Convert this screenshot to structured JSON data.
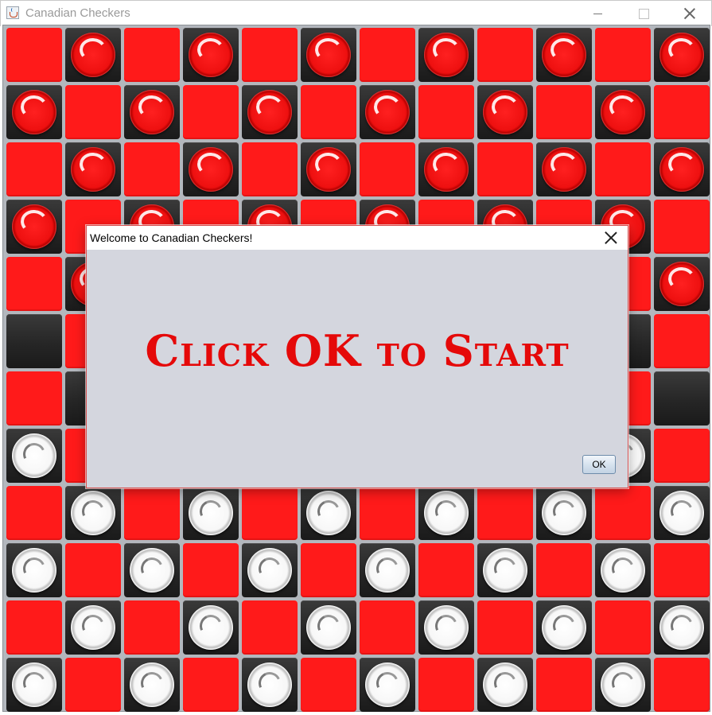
{
  "window": {
    "title": "Canadian Checkers",
    "controls": [
      "minimize",
      "maximize",
      "close"
    ]
  },
  "board": {
    "rows": 12,
    "cols": 12,
    "colors": {
      "light_square": "#ff1a1a",
      "dark_square": "#2a2a2a",
      "red_piece": "#ee1010",
      "white_piece": "#f7f7f7"
    },
    "layout": [
      ".r.r.r.r.r.r",
      "r.r.r.r.r.r.",
      ".r.r.r.r.r.r",
      "r.r.r.r.r.r.",
      ".r.r.r.r.r.r",
      "............",
      "............",
      "w.w.w.w.w.w.",
      ".w.w.w.w.w.w",
      "w.w.w.w.w.w.",
      ".w.w.w.w.w.w",
      "w.w.w.w.w.w."
    ]
  },
  "dialog": {
    "title": "Welcome to Canadian Checkers!",
    "message": "Click OK to Start",
    "ok_label": "OK"
  }
}
